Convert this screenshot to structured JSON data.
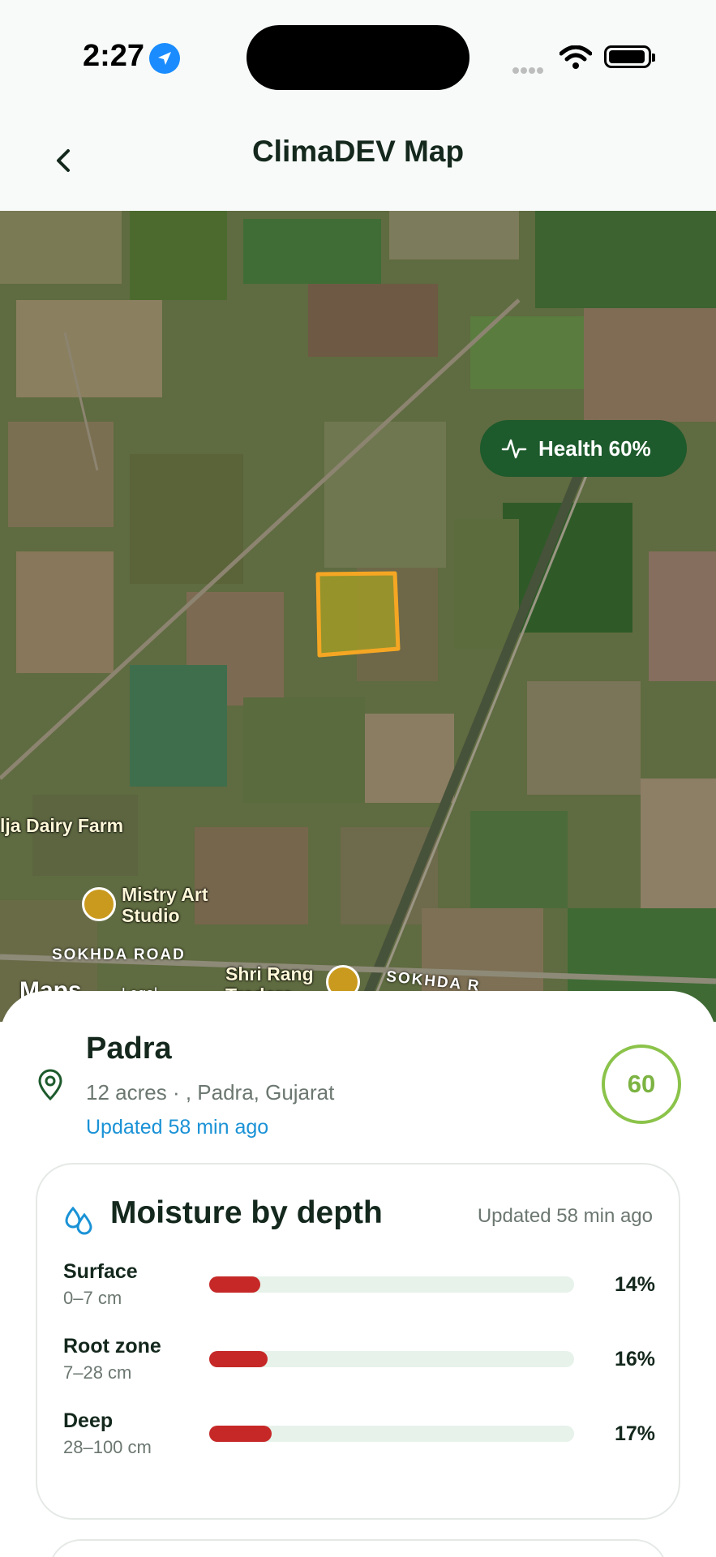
{
  "status_bar": {
    "time": "2:27",
    "location_icon": "location-arrow-icon",
    "wifi_icon": "wifi-icon",
    "battery_icon": "battery-icon"
  },
  "header": {
    "back_icon": "chevron-left-icon",
    "title": "ClimaDEV Map"
  },
  "map": {
    "health_icon": "activity-icon",
    "health_label": "Health 60%",
    "pois": [
      {
        "label": "lja Dairy Farm"
      },
      {
        "label": "Mistry Art\nStudio"
      },
      {
        "label": "Shri Rang\nTraders"
      }
    ],
    "roads": [
      "SOKHDA ROAD",
      "SOKHDA R"
    ],
    "attribution": {
      "maps": "Maps",
      "legal": "Legal"
    }
  },
  "field": {
    "pin_icon": "map-pin-icon",
    "name": "Padra",
    "subtitle": "12 acres · , Padra, Gujarat",
    "updated": "Updated 58 min ago",
    "score": "60",
    "score_color": "#7cb342"
  },
  "moisture": {
    "icon": "droplets-icon",
    "title": "Moisture by depth",
    "updated": "Updated 58 min ago",
    "bar_color": "#c62828",
    "track_color": "#e6f2ea",
    "rows": [
      {
        "name": "Surface",
        "depth": "0–7 cm",
        "value": "14%",
        "fraction": 0.14
      },
      {
        "name": "Root zone",
        "depth": "7–28 cm",
        "value": "16%",
        "fraction": 0.16
      },
      {
        "name": "Deep",
        "depth": "28–100 cm",
        "value": "17%",
        "fraction": 0.17
      }
    ]
  }
}
